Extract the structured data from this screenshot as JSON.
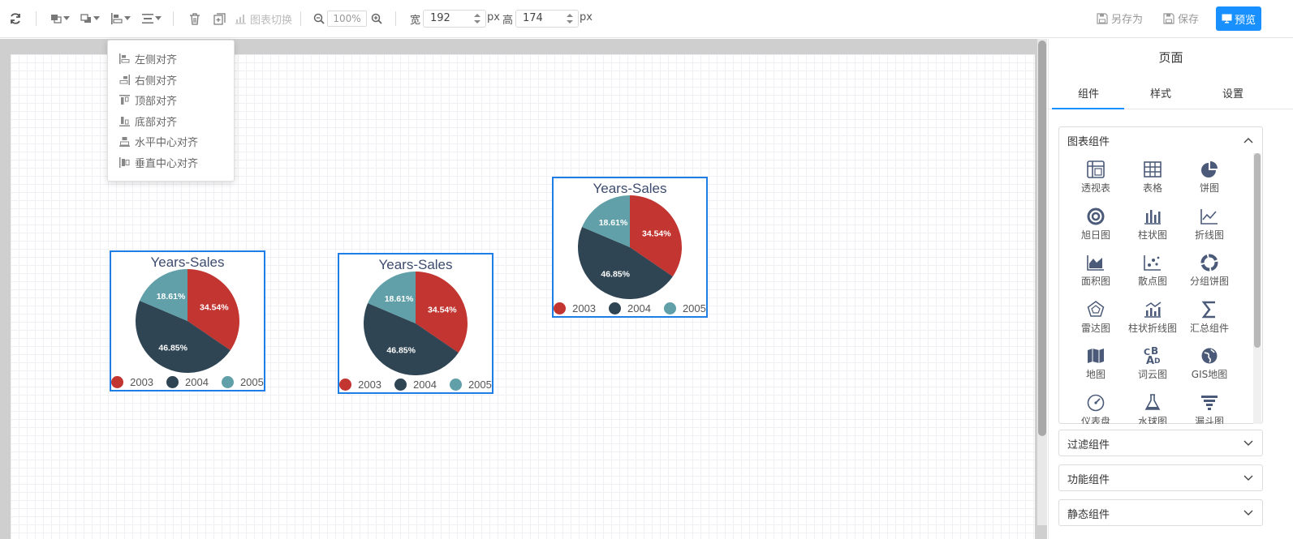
{
  "toolbar": {
    "chart_switch_label": "图表切换",
    "zoom_value": "100%",
    "width_label": "宽",
    "width_value": "192",
    "width_unit": "px",
    "height_label": "高",
    "height_value": "174",
    "height_unit": "px",
    "save_as_label": "另存为",
    "save_label": "保存",
    "preview_label": "预览"
  },
  "align_menu": {
    "items": [
      "左侧对齐",
      "右侧对齐",
      "顶部对齐",
      "底部对齐",
      "水平中心对齐",
      "垂直中心对齐"
    ]
  },
  "widgets": [
    {
      "title": "Years-Sales"
    },
    {
      "title": "Years-Sales"
    },
    {
      "title": "Years-Sales"
    }
  ],
  "colors": {
    "red": "#c23531",
    "dark": "#2f4554",
    "teal": "#61a0a8",
    "accent": "#1890ff",
    "selection": "#1e7ee6"
  },
  "chart_data": [
    {
      "type": "pie",
      "title": "Years-Sales",
      "legend": [
        "2003",
        "2004",
        "2005"
      ],
      "labels": [
        "34.54%",
        "46.85%",
        "18.61%"
      ],
      "values": [
        34.54,
        46.85,
        18.61
      ],
      "legend_position": "bottom"
    },
    {
      "type": "pie",
      "title": "Years-Sales",
      "legend": [
        "2003",
        "2004",
        "2005"
      ],
      "labels": [
        "34.54%",
        "46.85%",
        "18.61%"
      ],
      "values": [
        34.54,
        46.85,
        18.61
      ],
      "legend_position": "bottom"
    },
    {
      "type": "pie",
      "title": "Years-Sales",
      "legend": [
        "2003",
        "2004",
        "2005"
      ],
      "labels": [
        "34.54%",
        "46.85%",
        "18.61%"
      ],
      "values": [
        34.54,
        46.85,
        18.61
      ],
      "legend_position": "bottom"
    }
  ],
  "panel": {
    "title": "页面",
    "tabs": [
      "组件",
      "样式",
      "设置"
    ],
    "sections": {
      "chart": "图表组件",
      "filter": "过滤组件",
      "function": "功能组件",
      "static": "静态组件"
    },
    "components": [
      {
        "label": "透视表",
        "icon": "pivot-table-icon"
      },
      {
        "label": "表格",
        "icon": "table-icon"
      },
      {
        "label": "饼图",
        "icon": "pie-chart-icon"
      },
      {
        "label": "旭日图",
        "icon": "sunburst-icon"
      },
      {
        "label": "柱状图",
        "icon": "bar-chart-icon"
      },
      {
        "label": "折线图",
        "icon": "line-chart-icon"
      },
      {
        "label": "面积图",
        "icon": "area-chart-icon"
      },
      {
        "label": "散点图",
        "icon": "scatter-chart-icon"
      },
      {
        "label": "分组饼图",
        "icon": "grouped-pie-icon"
      },
      {
        "label": "雷达图",
        "icon": "radar-chart-icon"
      },
      {
        "label": "柱状折线图",
        "icon": "bar-line-chart-icon"
      },
      {
        "label": "汇总组件",
        "icon": "sum-icon"
      },
      {
        "label": "地图",
        "icon": "map-icon"
      },
      {
        "label": "词云图",
        "icon": "word-cloud-icon"
      },
      {
        "label": "GIS地图",
        "icon": "globe-icon"
      },
      {
        "label": "仪表盘",
        "icon": "gauge-icon"
      },
      {
        "label": "水球图",
        "icon": "liquid-fill-icon"
      },
      {
        "label": "漏斗图",
        "icon": "funnel-icon"
      }
    ]
  }
}
